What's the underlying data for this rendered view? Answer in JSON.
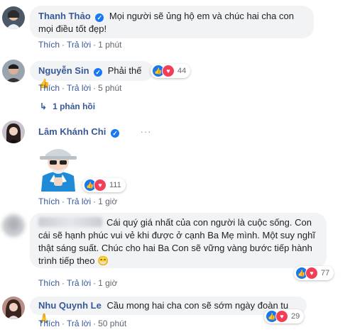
{
  "comments": [
    {
      "name": "Thanh Thảo",
      "text": "Mọi người sẽ ủng hộ em và chúc hai cha con mọi điều tốt đẹp!",
      "like": "Thích",
      "reply": "Trả lời",
      "time": "1 phút"
    },
    {
      "name": "Nguyễn Sin",
      "text": "Phải thế",
      "reaction_count": "44",
      "like": "Thích",
      "reply": "Trả lời",
      "time": "5 phút",
      "replies_link": "1 phản hồi"
    },
    {
      "name": "Lâm Khánh Chi",
      "sticker": "cartoon-grandpa-sticker",
      "reaction_count": "111",
      "like": "Thích",
      "reply": "Trả lời",
      "time": "1 giờ",
      "more": "···"
    },
    {
      "text": "Cái quý giá nhất của con người là cuộc sống. Con cái sẽ hạnh phúc vui vẻ khi được ở cạnh Ba Mẹ mình. Một suy nghĩ thật sáng suất. Chúc cho hai Ba Con sẽ vững vàng bước tiếp hành trình tiếp theo",
      "emoji": "😁",
      "reaction_count": "77",
      "like": "Thích",
      "reply": "Trả lời",
      "time": "1 giờ"
    },
    {
      "name": "Nhu Quynh Le",
      "text": "Cầu mong hai cha con sẽ sớm ngày đoàn tụ",
      "emoji": "🙏",
      "reaction_count": "29",
      "like": "Thích",
      "reply": "Trả lời",
      "time": "50 phút"
    }
  ],
  "colors": {
    "link": "#385898",
    "bubble": "#f2f3f5",
    "like": "#1877f2",
    "love": "#f33e58"
  }
}
